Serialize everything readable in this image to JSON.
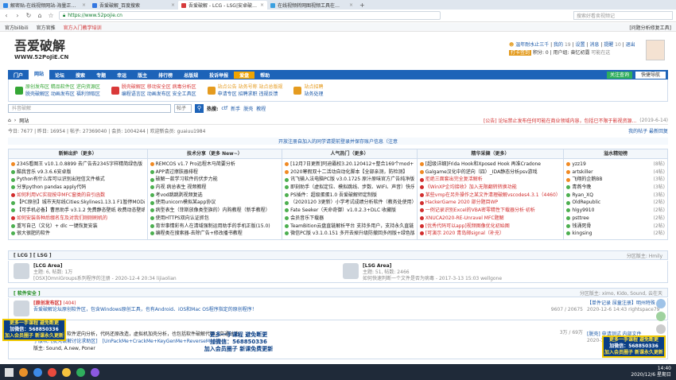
{
  "tabs": [
    {
      "label": "解密贴-在线视频网站-海量正…",
      "color": "#2d86e6"
    },
    {
      "label": "吾爱破解_百度搜索",
      "color": "#3477e0"
    },
    {
      "label": "吾爱破解 - LCG - LSG|安卓破…",
      "color": "#d63b3b"
    },
    {
      "label": "在线视频转网图视频工具在…",
      "color": "#3aa0e0"
    }
  ],
  "address": {
    "url": "https://www.52pojie.cn",
    "secure_mark": "▲",
    "search_placeholder": "搜索好看卖视频记"
  },
  "bookmarks": [
    "官方bilibili",
    "官方官推",
    "官方入门教学培训"
  ],
  "top_notice": "[问题分析修复工具]",
  "logo": {
    "line1": "吾爱破解",
    "line2": "WWW.52PoJiE.CN"
  },
  "user": {
    "name": "温年耐水止三千",
    "links": [
      "我的",
      "设置",
      "消息",
      "提醒",
      "退出"
    ],
    "level_badge": "打卡签到",
    "credits": "积分: 0",
    "user_group": "用户组: 奋忆初露",
    "extra": "可能在这",
    "nums": [
      "19",
      "10"
    ]
  },
  "nav": {
    "items": [
      "门户",
      "网站",
      "论坛",
      "搜索",
      "专题",
      "幸运",
      "版主",
      "排行榜",
      "总版规",
      "投诉举报",
      "爱盘",
      "帮助"
    ],
    "active": 1,
    "highlight": 10,
    "quick_label": "快捷导航",
    "status_label": "关注查询"
  },
  "subnav": [
    {
      "color": "#35a635",
      "lines": [
        "原创发布区 精品软件区 逆向资源区",
        "脱壳破解区 动画发布区 福利领取区"
      ]
    },
    {
      "color": "#d93939",
      "lines": [
        "脱壳破解区 移动安全区 病毒分析区",
        "编程语言区 动画发布区 安全工具区"
      ]
    },
    {
      "color": "#e59b1f",
      "lines": [
        "站点公告 站务号称 站点总版规",
        "申请专区 招聘求职 违规反馈"
      ]
    },
    {
      "color": "#e59b1f",
      "lines": [
        "站点招聘",
        "站务处理"
      ]
    }
  ],
  "search": {
    "placeholder": "抖音破解",
    "select": "帖子",
    "hot_label": "热搜:",
    "hot": [
      "ctf",
      "新手",
      "脱壳",
      "教程"
    ]
  },
  "breadcrumb": {
    "home": "⌂",
    "section": "网站",
    "notice": "[公告] 论坛禁止发布任何可能在商业领域内容，包括已不限于影视资源...",
    "date": "(2019-6-14)"
  },
  "stats": {
    "text": "今日: 7677 | 昨日: 16954 | 帖子: 27369040 | 会员: 1004244 | 欢迎新会员: guaiuu1984",
    "right": "我的帖子  最新回复"
  },
  "notice_bar": "开放注册自加入的同学请提前登录并保存账户信息（注意",
  "columns": [
    {
      "title": "新鲜出炉（更多）",
      "items": [
        {
          "t": "2345看图王 v10.1.0.8899 去广告去2345字样精简绿色版【12.",
          "c": "#f08a24"
        },
        {
          "t": "酷我音乐 v9.3.6.6安卓版",
          "c": "#4caf50"
        },
        {
          "t": "Python有什么库可以识别出短信文件格式",
          "c": "#4caf50"
        },
        {
          "t": "分享python pandas apply代码",
          "c": "#4caf50"
        },
        {
          "t": "如何利用VC实现按中MFC窗类的自引函数",
          "c": "#d12d2d"
        },
        {
          "t": "【PC原创】城市天际线Cities:Skylines1.13.1 F1暂停MOD改版",
          "c": "#4caf50"
        },
        {
          "t": "【可手机必备】曹思助手 v3.1.2 免费静态壁纸 收费动态壁纸",
          "c": "#4caf50"
        },
        {
          "t": "如何安装各种后缀名车及对我们刚刚刷机的",
          "c": "#d12d2d"
        },
        {
          "t": "重写自己（文化）+ dlc 一键恢复安装",
          "c": "#4caf50"
        },
        {
          "t": "很大很肥的软件",
          "c": "#4caf50"
        }
      ]
    },
    {
      "title": "技术分享（更多 New~）",
      "items": [
        {
          "t": "REMCOS v1.7 Pro远程木马简要分析",
          "c": "#f08a24"
        },
        {
          "t": "APP请过擦肤器排程",
          "c": "#4caf50"
        },
        {
          "t": "破解一款学习软件的伏步力能",
          "c": "#4caf50"
        },
        {
          "t": "内视 病总表生 视频教程",
          "c": "#4caf50"
        },
        {
          "t": "考vod跳跳剥视频复选",
          "c": "#4caf50"
        },
        {
          "t": "使用unicorn模拟某app协议",
          "c": "#4caf50"
        },
        {
          "t": "病型表生（菲斯放像类型旗的）内购教程（新手教程）",
          "c": "#4caf50"
        },
        {
          "t": "使用HTTPS双向认证抓包",
          "c": "#4caf50"
        },
        {
          "t": "育世事情彩有人在清域强制运用助手的手机正版(15.0)",
          "c": "#4caf50"
        },
        {
          "t": "编程类在搜索器-去除广告+修改播书教程",
          "c": "#4caf50"
        }
      ]
    },
    {
      "title": "人气热门（更多）",
      "items": [
        {
          "t": "[12月7日更新]阿迪霸权3.20.120412+整合169个mod+167条事",
          "c": "#f08a24"
        },
        {
          "t": "2020寒假双十二活动自动化脚本【全部亲测，防检测】",
          "c": "#f08a24"
        },
        {
          "t": "讯飞输入法电脑PC版 v3.0.1725 原汁原味官方广告纯净版",
          "c": "#4caf50"
        },
        {
          "t": "即刻助手（虚拟定位、模拟跳线、步数、WIFI、声音）快乐派",
          "c": "#4caf50"
        },
        {
          "t": "PS插件：超级蛋蛋1.0 吾爱破解师定制版",
          "c": "#4caf50"
        },
        {
          "t": "（2020120 3更新）小学考试成绩分析软件（教务处使用）",
          "c": "#4caf50"
        },
        {
          "t": "Fate Seeker（天命奇御）v1.0.2.3+DLC 收藏版",
          "c": "#4caf50"
        },
        {
          "t": "会员音乐下载器",
          "c": "#4caf50"
        },
        {
          "t": "TeamBition云盘直链解析平台 支持多用户，支持永久直链，支",
          "c": "#4caf50"
        },
        {
          "t": "微信PC版 v3.1.0.151 多开去掉升级防撤回多闹版+绿色版（精修版）",
          "c": "#4caf50"
        }
      ]
    },
    {
      "title": "精华采撷（更多）",
      "items": [
        {
          "t": "[超级详细]Frida Hook和Xposed Hook 再准Cradone",
          "c": "#f08a24"
        },
        {
          "t": "Galgame汉化中的逆向（四）_IDA静态分析psv游戏",
          "c": "#f08a24"
        },
        {
          "t": "拒绝三面套出完全复活解析",
          "c": "#d12d2d"
        },
        {
          "t": "《WinXP企均接收》加入无限翻转转换功能",
          "c": "#d12d2d"
        },
        {
          "t": "某些vmp在另外操作之某文件清理破解vscodes4.3.1（4460）分析",
          "c": "#d12d2d"
        },
        {
          "t": "HackerGame 2020 部分题目WP",
          "c": "#d12d2d"
        },
        {
          "t": "一例记录识别Excel的VBA密零精性下载器分析·初析",
          "c": "#d12d2d"
        },
        {
          "t": "XNUCA2020-RE-Unravel MFC题解",
          "c": "#d12d2d"
        },
        {
          "t": "[优秀代码可以app]视频图像优化初始图",
          "c": "#d12d2d"
        },
        {
          "t": "[可演示 2020 青岛邮signal（补充）",
          "c": "#d12d2d"
        }
      ]
    },
    {
      "title": "溢水精短榜",
      "items": [
        {
          "t": "yzz19",
          "r": "(8帖)",
          "c": "#f08a24"
        },
        {
          "t": "artskiller",
          "r": "(4帖)",
          "c": "#f08a24"
        },
        {
          "t": "飞翔的企鹅BB",
          "r": "(3帖)",
          "c": "#f08a24"
        },
        {
          "t": "青燕今晚",
          "r": "(3帖)",
          "c": "#4caf50"
        },
        {
          "t": "Ryan_XQ",
          "r": "(3帖)",
          "c": "#4caf50"
        },
        {
          "t": "OldRepublic",
          "r": "(2帖)",
          "c": "#4caf50"
        },
        {
          "t": "hlgy9910",
          "r": "(2帖)",
          "c": "#4caf50"
        },
        {
          "t": "psttree",
          "r": "(2帖)",
          "c": "#4caf50"
        },
        {
          "t": "钱涌死骨",
          "r": "(2帖)",
          "c": "#4caf50"
        },
        {
          "t": "kingsing",
          "r": "(2帖)",
          "c": "#4caf50"
        }
      ]
    }
  ],
  "lcg_header": {
    "title": "[ LCG ] [ LSG ]",
    "right": "分区版主: Hmily"
  },
  "lcg": [
    {
      "name": "[LCG Area]",
      "stats": "主题: 6, 帖数: 1万",
      "last": "[OSX]OmniGroups系列程序的注册 - 2020-12-4 20:34 lijiaolian"
    },
    {
      "name": "[LSG Area]",
      "stats": "主题: 51, 帖数: 2466",
      "last": "如何快速判断一个文件是否为病毒 - 2017-3-13 15:03 wellgone"
    }
  ],
  "soft_header": {
    "title": "[ 软件安全 ]",
    "right": "分区版主: ximo, Kido, Sound, 云在天"
  },
  "forum1": {
    "name": "[原创发布区]",
    "count": "(404)",
    "desc": "吾爱破解论坛原创软件区，包含Windows原创工具，也有Android、iOS和Mac OS程序指定的原创程序！",
    "stats": "9607 / 20675",
    "last_title": "【单件记录 尿童注册】明州特殊",
    "last_time": "2020-12-6 14:43 rightspace79"
  },
  "forum2": {
    "name": "[脱壳破解区]",
    "desc": "吾爱破解论坛：软件逆向分析，代码还原改造，虚拟机加壳分析，也包括软件破解代码，交通讨论。",
    "stats": "3万 / 69万",
    "last_title": "[脱壳] 申请测试 内部文件",
    "last_time": "2020-12-6 14:47 夕日"
  },
  "forum2_sub": "子版块: [脱壳破解讨论求助区]　[UnPackMe+CrackMe+KeyGenMe+ReverseMe]",
  "forum2_mods": "版主: Sound, A.new, Poner",
  "ads": {
    "left_lines": [
      "更多一手课程 避免断更",
      "加微信：568850336",
      "加入会员圈子 新课永久更新"
    ],
    "center_lines": [
      "更多一手课程 避免断更",
      "加微信：568850336",
      "加入会员圈子 新课免费更新"
    ],
    "right_lines": [
      "更多一手课程 避免断更",
      "加微信：568850336",
      "加入会员圈子 新课永久更新"
    ]
  },
  "taskbar": {
    "time": "14:40",
    "date": "2020/12/6 星期日"
  }
}
